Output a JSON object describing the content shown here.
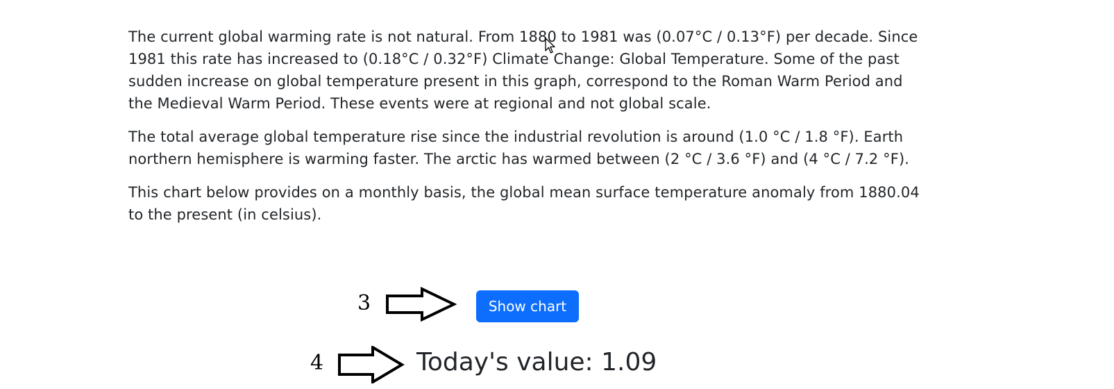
{
  "article": {
    "paragraphs": [
      "The current global warming rate is not natural. From 1880 to 1981 was (0.07°C / 0.13°F) per decade. Since 1981 this rate has increased to (0.18°C / 0.32°F) Climate Change: Global Temperature. Some of the past sudden increase on global temperature present in this graph, correspond to the Roman Warm Period and the Medieval Warm Period. These events were at regional and not global scale.",
      "The total average global temperature rise since the industrial revolution is around (1.0 °C / 1.8 °F). Earth northern hemisphere is warming faster. The arctic has warmed between (2 °C / 3.6 °F) and (4 °C / 7.2 °F).",
      "This chart below provides on a monthly basis, the global mean surface temperature anomaly from 1880.04 to the present (in celsius)."
    ]
  },
  "annotations": {
    "step_3": "3",
    "step_4": "4"
  },
  "actions": {
    "show_chart_label": "Show chart"
  },
  "today": {
    "text": "Today's value: 1.09"
  },
  "colors": {
    "button_bg": "#0d6efd",
    "text": "#212529"
  },
  "icons": {
    "arrow": "right-arrow-outline-icon",
    "cursor": "mouse-pointer-icon"
  }
}
